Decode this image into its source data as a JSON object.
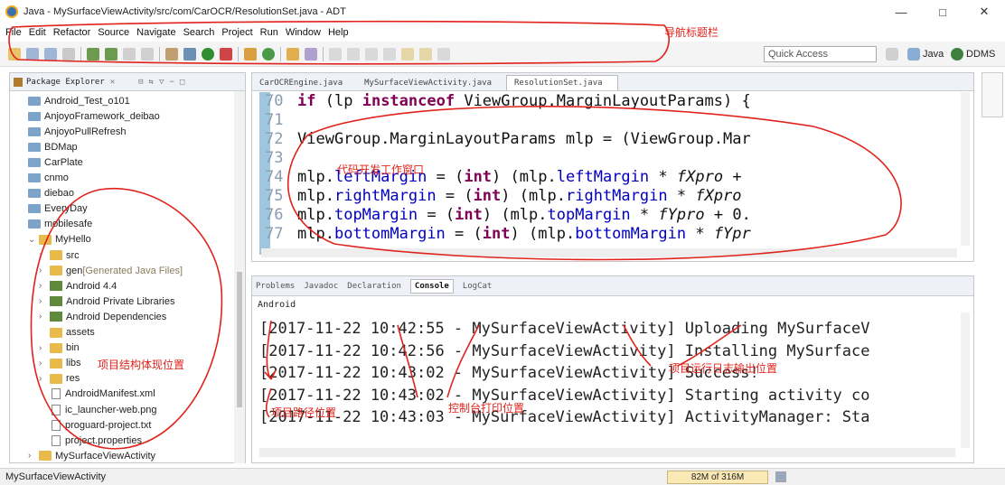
{
  "window": {
    "title": "Java - MySurfaceViewActivity/src/com/CarOCR/ResolutionSet.java - ADT",
    "minimize": "—",
    "maximize": "□",
    "close": "✕"
  },
  "menu": [
    "File",
    "Edit",
    "Refactor",
    "Source",
    "Navigate",
    "Search",
    "Project",
    "Run",
    "Window",
    "Help"
  ],
  "toolbar": {
    "quick_access_placeholder": "Quick Access",
    "perspectives": [
      "Java",
      "DDMS"
    ]
  },
  "annotations": {
    "nav_title_bar": "导航标题栏",
    "code_window": "代码开发工作窗口",
    "project_structure": "项目结构体现位置",
    "log_output": "项目运行日志输出位置",
    "console_print": "控制台打印位置",
    "project_location": "项目路径位置"
  },
  "package_explorer": {
    "tab_label": "Package Explorer",
    "items": [
      {
        "label": "Android_Test_o101",
        "type": "folder",
        "indent": 0
      },
      {
        "label": "AnjoyoFramework_deibao",
        "type": "folder",
        "indent": 0
      },
      {
        "label": "AnjoyoPullRefresh",
        "type": "folder",
        "indent": 0
      },
      {
        "label": "BDMap",
        "type": "folder",
        "indent": 0
      },
      {
        "label": "CarPlate",
        "type": "folder",
        "indent": 0
      },
      {
        "label": "cnmo",
        "type": "folder",
        "indent": 0
      },
      {
        "label": "diebao",
        "type": "folder",
        "indent": 0
      },
      {
        "label": "EveryDay",
        "type": "folder",
        "indent": 0
      },
      {
        "label": "mobilesafe",
        "type": "folder",
        "indent": 0
      },
      {
        "label": "MyHello",
        "type": "project",
        "indent": 0,
        "expanded": true
      },
      {
        "label": "src",
        "type": "pkg",
        "indent": 1
      },
      {
        "label": "gen",
        "suffix": " [Generated Java Files]",
        "type": "pkg",
        "indent": 1
      },
      {
        "label": "Android 4.4",
        "type": "lib",
        "indent": 1
      },
      {
        "label": "Android Private Libraries",
        "type": "lib",
        "indent": 1
      },
      {
        "label": "Android Dependencies",
        "type": "lib",
        "indent": 1
      },
      {
        "label": "assets",
        "type": "pkg",
        "indent": 1,
        "noarrow": true
      },
      {
        "label": "bin",
        "type": "pkg",
        "indent": 1
      },
      {
        "label": "libs",
        "type": "pkg",
        "indent": 1
      },
      {
        "label": "res",
        "type": "pkg",
        "indent": 1
      },
      {
        "label": "AndroidManifest.xml",
        "type": "file",
        "indent": 1
      },
      {
        "label": "ic_launcher-web.png",
        "type": "file",
        "indent": 1
      },
      {
        "label": "proguard-project.txt",
        "type": "file",
        "indent": 1
      },
      {
        "label": "project.properties",
        "type": "file",
        "indent": 1
      },
      {
        "label": "MySurfaceViewActivity",
        "type": "project",
        "indent": 0
      }
    ]
  },
  "editor": {
    "tabs": [
      "CarOCREngine.java",
      "MySurfaceViewActivity.java",
      "ResolutionSet.java"
    ],
    "active_tab": 2,
    "lines": [
      {
        "num": "70",
        "text": "        if (lp instanceof ViewGroup.MarginLayoutParams) {"
      },
      {
        "num": "71",
        "text": ""
      },
      {
        "num": "72",
        "text": "            ViewGroup.MarginLayoutParams mlp = (ViewGroup.Mar"
      },
      {
        "num": "73",
        "text": ""
      },
      {
        "num": "74",
        "text": "            mlp.leftMargin = (int) (mlp.leftMargin * fXpro +"
      },
      {
        "num": "75",
        "text": "            mlp.rightMargin = (int) (mlp.rightMargin * fXpro"
      },
      {
        "num": "76",
        "text": "            mlp.topMargin = (int) (mlp.topMargin * fYpro + 0."
      },
      {
        "num": "77",
        "text": "            mlp.bottomMargin = (int) (mlp.bottomMargin * fYpr"
      }
    ]
  },
  "console": {
    "tabs": [
      "Problems",
      "Javadoc",
      "Declaration",
      "Console",
      "LogCat"
    ],
    "active_tab": 3,
    "label": "Android",
    "lines": [
      "[2017-11-22 10:42:55 - MySurfaceViewActivity] Uploading MySurfaceV",
      "[2017-11-22 10:42:56 - MySurfaceViewActivity] Installing MySurface",
      "[2017-11-22 10:43:02 - MySurfaceViewActivity] Success!",
      "[2017-11-22 10:43:02 - MySurfaceViewActivity] Starting activity co",
      "[2017-11-22 10:43:03 - MySurfaceViewActivity] ActivityManager: Sta"
    ]
  },
  "status": {
    "left": "MySurfaceViewActivity",
    "memory": "82M of 316M"
  }
}
